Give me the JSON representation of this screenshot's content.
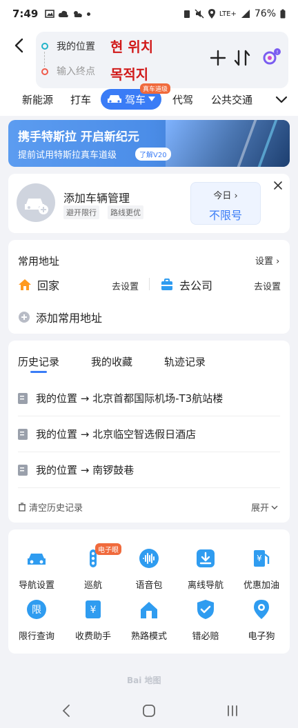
{
  "status": {
    "time": "7:49",
    "battery": "76%",
    "signal": "LTE+"
  },
  "route": {
    "start": "我的位置",
    "start_note": "현 위치",
    "end_placeholder": "输入终点",
    "end_note": "목적지"
  },
  "tabs": [
    {
      "label": "新能源"
    },
    {
      "label": "打车"
    },
    {
      "label": "驾车",
      "badge": "真车道级",
      "active": true
    },
    {
      "label": "代驾"
    },
    {
      "label": "公共交通"
    }
  ],
  "banner": {
    "title": "携手特斯拉 开启新纪元",
    "subtitle": "提前试用特斯拉真车道级",
    "learn": "了解V20"
  },
  "vehicle": {
    "title": "添加车辆管理",
    "tags": [
      "避开限行",
      "路线更优"
    ],
    "today_label": "今日",
    "today_value": "不限号"
  },
  "address": {
    "title": "常用地址",
    "setting": "设置",
    "home": "回家",
    "home_action": "去设置",
    "work": "去公司",
    "work_action": "去设置",
    "add": "添加常用地址"
  },
  "history": {
    "tabs": [
      "历史记录",
      "我的收藏",
      "轨迹记录"
    ],
    "items": [
      "我的位置 → 北京首都国际机场-T3航站楼",
      "我的位置 → 北京临空智选假日酒店",
      "我的位置 → 南锣鼓巷"
    ],
    "clear": "清空历史记录",
    "expand": "展开"
  },
  "tools": {
    "badge": "电子眼",
    "items": [
      {
        "label": "导航设置",
        "icon": "car-settings-icon"
      },
      {
        "label": "巡航",
        "icon": "traffic-light-icon"
      },
      {
        "label": "语音包",
        "icon": "voice-icon"
      },
      {
        "label": "离线导航",
        "icon": "download-icon"
      },
      {
        "label": "优惠加油",
        "icon": "fuel-icon"
      },
      {
        "label": "限行查询",
        "icon": "restriction-icon"
      },
      {
        "label": "收费助手",
        "icon": "toll-icon"
      },
      {
        "label": "熟路模式",
        "icon": "familiar-route-icon"
      },
      {
        "label": "错必赔",
        "icon": "shield-check-icon"
      },
      {
        "label": "电子狗",
        "icon": "camera-pin-icon"
      }
    ]
  },
  "footer": {
    "logo": "Bai 地图"
  },
  "colors": {
    "accent": "#3a7cf6",
    "badge": "#f06a3c",
    "annotation": "#d11a1a"
  }
}
